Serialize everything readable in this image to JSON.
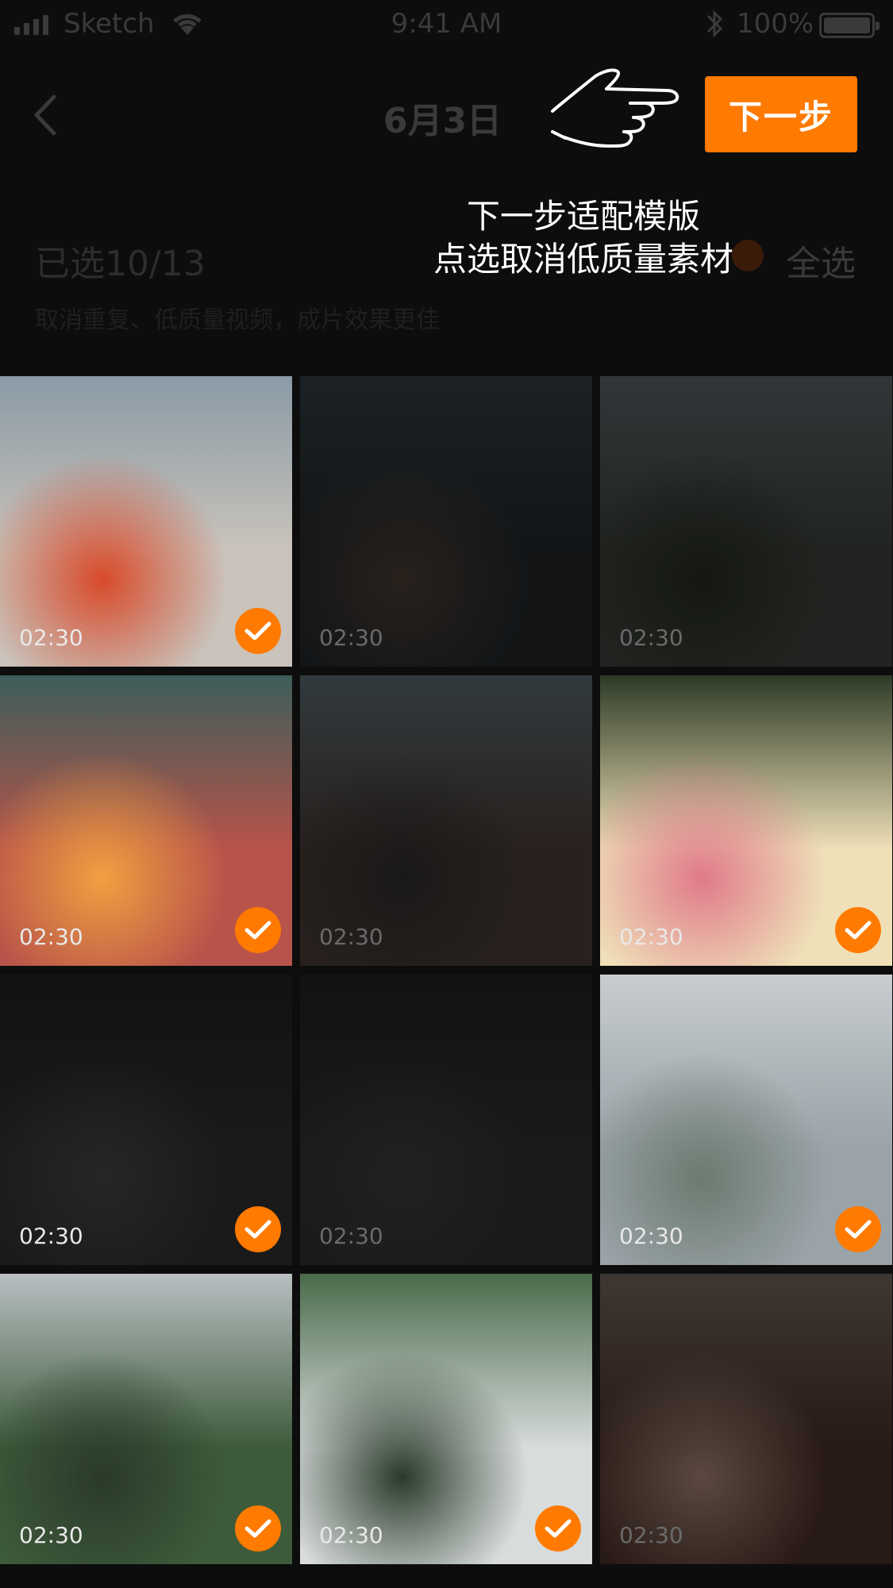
{
  "status_bar": {
    "carrier": "Sketch",
    "time": "9:41 AM",
    "battery": "100%"
  },
  "nav": {
    "title": "6月3日",
    "next_label": "下一步"
  },
  "tip": {
    "line1": "下一步适配模版",
    "line2": "点选取消低质量素材"
  },
  "selection": {
    "count_label": "已选10/13",
    "hint": "取消重复、低质量视频，成片效果更佳",
    "select_all": "全选"
  },
  "colors": {
    "accent": "#ff7a00",
    "background": "#0d0d0d"
  },
  "grid": {
    "items": [
      {
        "name": "red-car",
        "duration": "02:30",
        "selected": true,
        "colors": [
          "#8a9aa6",
          "#c9c3bb",
          "#d84a2a"
        ]
      },
      {
        "name": "woman-sunglasses",
        "duration": "02:30",
        "selected": false,
        "colors": [
          "#3d4a52",
          "#2a3034",
          "#5a4a40"
        ]
      },
      {
        "name": "old-bridge",
        "duration": "02:30",
        "selected": false,
        "colors": [
          "#6c7a80",
          "#4a5048",
          "#2f3528"
        ]
      },
      {
        "name": "fence-bokeh",
        "duration": "02:30",
        "selected": true,
        "colors": [
          "#3c5e5a",
          "#b8534a",
          "#f0a040"
        ]
      },
      {
        "name": "plaza-building",
        "duration": "02:30",
        "selected": false,
        "colors": [
          "#6e8088",
          "#5a4a44",
          "#3a3836"
        ]
      },
      {
        "name": "flowers-white",
        "duration": "02:30",
        "selected": true,
        "colors": [
          "#2d3a26",
          "#efe0b8",
          "#e07a8a"
        ]
      },
      {
        "name": "dark-plant",
        "duration": "02:30",
        "selected": true,
        "colors": [
          "#121212",
          "#1a1a1a",
          "#262626"
        ]
      },
      {
        "name": "flower-dark",
        "duration": "02:30",
        "selected": false,
        "colors": [
          "#2a2a2a",
          "#3a3a3a",
          "#4a4a4a"
        ]
      },
      {
        "name": "dome-glass",
        "duration": "02:30",
        "selected": true,
        "colors": [
          "#c8cdd0",
          "#9aa3a8",
          "#6c7a70"
        ]
      },
      {
        "name": "dome-waterfall",
        "duration": "02:30",
        "selected": true,
        "colors": [
          "#b8bfc2",
          "#3d5a3a",
          "#2a3a2a"
        ]
      },
      {
        "name": "waterfall-train",
        "duration": "02:30",
        "selected": true,
        "colors": [
          "#4a6a4a",
          "#d8dcdc",
          "#2a3a2a"
        ]
      },
      {
        "name": "milkshake",
        "duration": "02:30",
        "selected": false,
        "colors": [
          "#8a7a70",
          "#5a3a30",
          "#c8a090"
        ]
      }
    ]
  }
}
